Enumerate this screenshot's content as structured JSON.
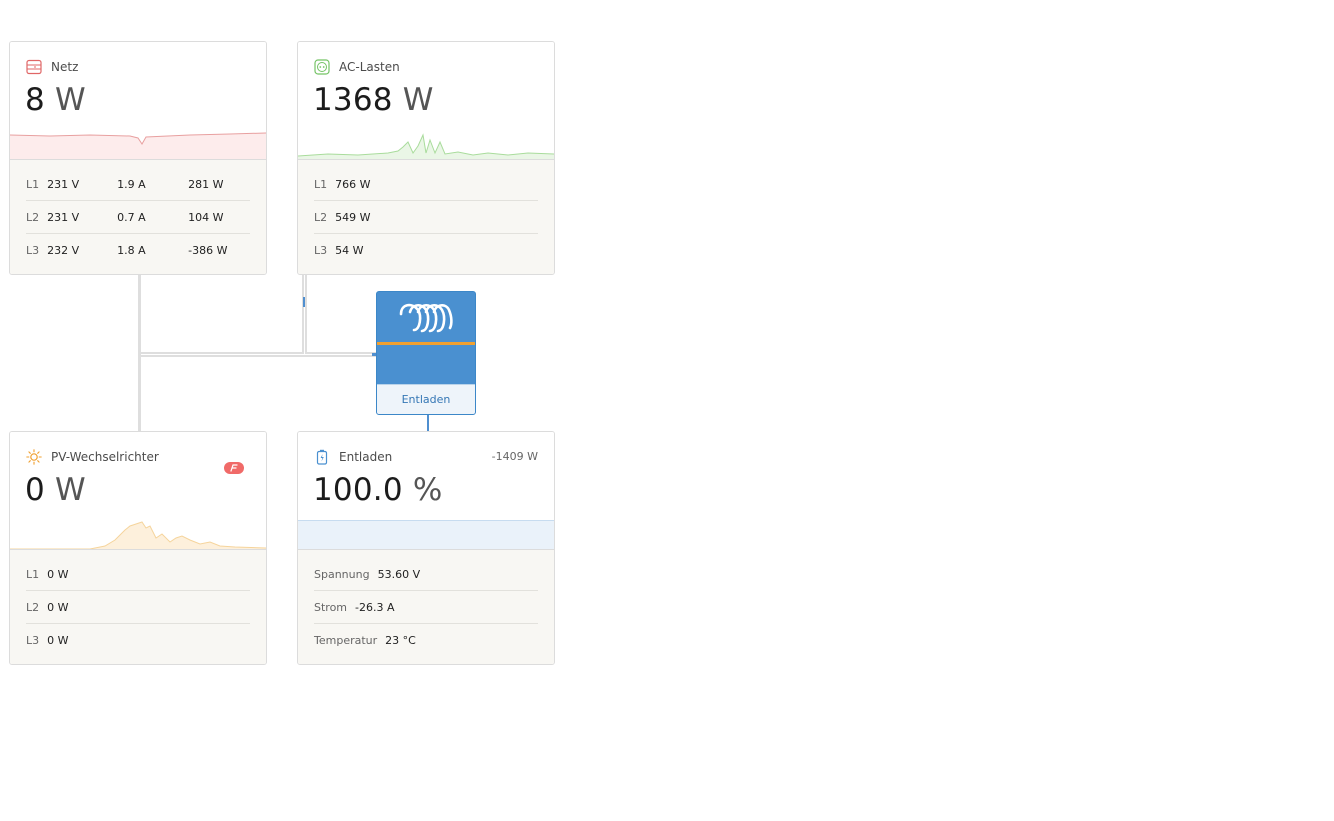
{
  "grid": {
    "title": "Netz",
    "value": "8",
    "unit": "W",
    "icon": "grid-icon",
    "color": "#e06666",
    "phases": [
      {
        "label": "L1",
        "voltage": "231 V",
        "current": "1.9 A",
        "power": "281 W"
      },
      {
        "label": "L2",
        "voltage": "231 V",
        "current": "0.7 A",
        "power": "104 W"
      },
      {
        "label": "L3",
        "voltage": "232 V",
        "current": "1.8 A",
        "power": "-386 W"
      }
    ]
  },
  "ac_loads": {
    "title": "AC-Lasten",
    "value": "1368",
    "unit": "W",
    "icon": "outlet-icon",
    "color": "#74c365",
    "phases": [
      {
        "label": "L1",
        "power": "766 W"
      },
      {
        "label": "L2",
        "power": "549 W"
      },
      {
        "label": "L3",
        "power": "54 W"
      }
    ]
  },
  "pv_inverter": {
    "title": "PV-Wechselrichter",
    "value": "0",
    "unit": "W",
    "icon": "sun-icon",
    "color": "#f0a030",
    "alarm_icon": "alarm-icon",
    "phases": [
      {
        "label": "L1",
        "power": "0 W"
      },
      {
        "label": "L2",
        "power": "0 W"
      },
      {
        "label": "L3",
        "power": "0 W"
      }
    ]
  },
  "battery": {
    "title": "Entladen",
    "power": "-1409 W",
    "value": "100.0",
    "unit": "%",
    "icon": "battery-icon",
    "color": "#4a90d0",
    "level_fraction": 1.0,
    "rows": [
      {
        "label": "Spannung",
        "value": "53.60 V"
      },
      {
        "label": "Strom",
        "value": "-26.3 A"
      },
      {
        "label": "Temperatur",
        "value": "23 °C"
      }
    ]
  },
  "inverter": {
    "logo_icon": "victron-logo-icon",
    "state": "Entladen",
    "colors": {
      "body": "#4a90d0",
      "stripe": "#f0a030"
    }
  }
}
